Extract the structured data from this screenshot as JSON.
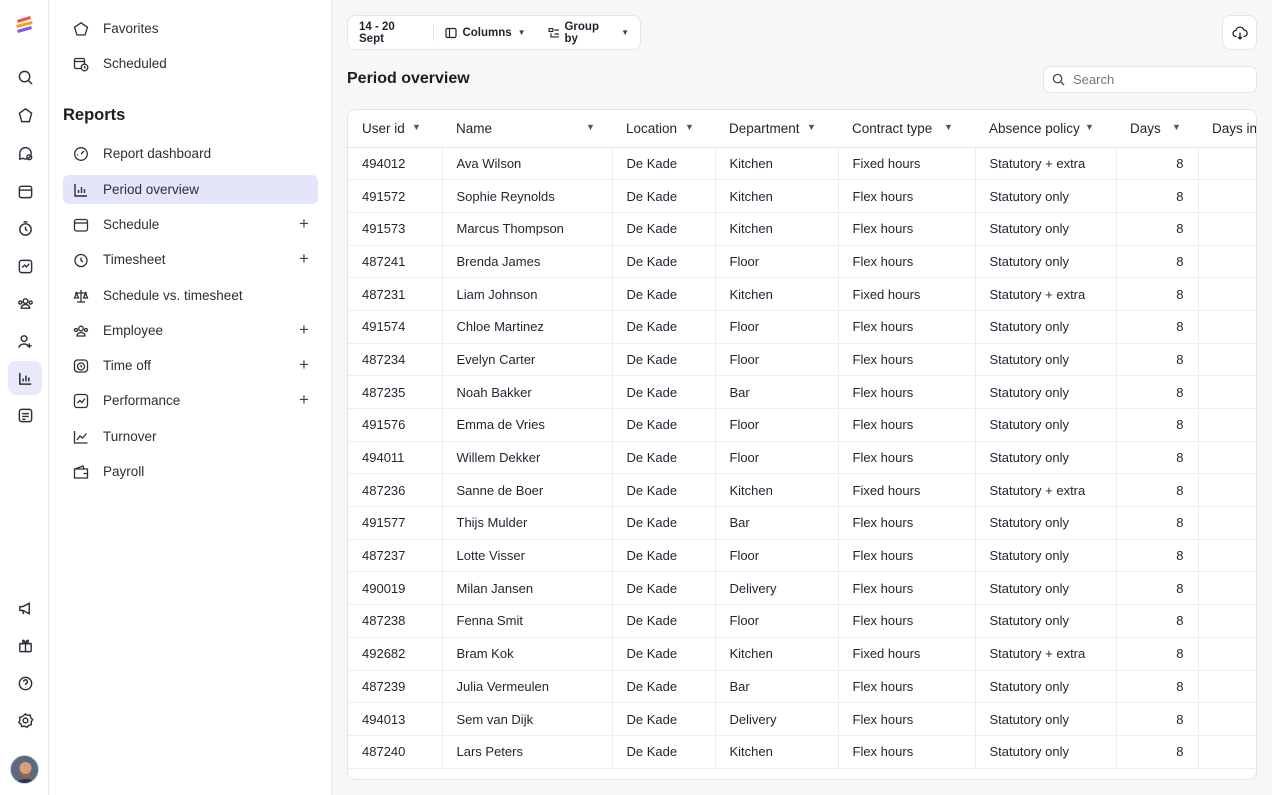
{
  "rail": {
    "icons": [
      "search-icon",
      "inbox-icon",
      "chat-icon",
      "calendar-icon",
      "clock-icon",
      "check-square-icon",
      "team-icon",
      "add-user-icon",
      "reports-icon",
      "list-icon"
    ],
    "bottom_icons": [
      "megaphone-icon",
      "gift-icon",
      "help-icon",
      "settings-icon"
    ]
  },
  "sidebar": {
    "favorites": "Favorites",
    "scheduled": "Scheduled",
    "section_title": "Reports",
    "items": [
      {
        "label": "Report dashboard",
        "icon": "dashboard-icon",
        "expandable": false
      },
      {
        "label": "Period overview",
        "icon": "bar-chart-icon",
        "expandable": false,
        "active": true
      },
      {
        "label": "Schedule",
        "icon": "calendar-icon",
        "expandable": true
      },
      {
        "label": "Timesheet",
        "icon": "clock-icon",
        "expandable": true
      },
      {
        "label": "Schedule vs. timesheet",
        "icon": "scale-icon",
        "expandable": false
      },
      {
        "label": "Employee",
        "icon": "team-icon",
        "expandable": true
      },
      {
        "label": "Time off",
        "icon": "alarm-icon",
        "expandable": true
      },
      {
        "label": "Performance",
        "icon": "chart-square-icon",
        "expandable": true
      },
      {
        "label": "Turnover",
        "icon": "trend-line-icon",
        "expandable": false
      },
      {
        "label": "Payroll",
        "icon": "wallet-icon",
        "expandable": false
      }
    ]
  },
  "toolbar": {
    "date_range": "14 - 20 Sept",
    "columns_label": "Columns",
    "group_by_label": "Group by"
  },
  "main": {
    "title": "Period overview",
    "search_placeholder": "Search"
  },
  "table": {
    "columns": [
      "User id",
      "Name",
      "Location",
      "Department",
      "Contract type",
      "Absence policy",
      "Days",
      "Days in"
    ],
    "rows": [
      [
        "494012",
        "Ava Wilson",
        "De Kade",
        "Kitchen",
        "Fixed hours",
        "Statutory + extra",
        "8"
      ],
      [
        "491572",
        "Sophie Reynolds",
        "De Kade",
        "Kitchen",
        "Flex hours",
        "Statutory only",
        "8"
      ],
      [
        "491573",
        "Marcus Thompson",
        "De Kade",
        "Kitchen",
        "Flex hours",
        "Statutory only",
        "8"
      ],
      [
        "487241",
        "Brenda James",
        "De Kade",
        "Floor",
        "Flex hours",
        "Statutory only",
        "8"
      ],
      [
        "487231",
        "Liam Johnson",
        "De Kade",
        "Kitchen",
        "Fixed hours",
        "Statutory + extra",
        "8"
      ],
      [
        "491574",
        "Chloe Martinez",
        "De Kade",
        "Floor",
        "Flex hours",
        "Statutory only",
        "8"
      ],
      [
        "487234",
        "Evelyn Carter",
        "De Kade",
        "Floor",
        "Flex hours",
        "Statutory only",
        "8"
      ],
      [
        "487235",
        "Noah Bakker",
        "De Kade",
        "Bar",
        "Flex hours",
        "Statutory only",
        "8"
      ],
      [
        "491576",
        "Emma de Vries",
        "De Kade",
        "Floor",
        "Flex hours",
        "Statutory only",
        "8"
      ],
      [
        "494011",
        "Willem Dekker",
        "De Kade",
        "Floor",
        "Flex hours",
        "Statutory only",
        "8"
      ],
      [
        "487236",
        "Sanne de Boer",
        "De Kade",
        "Kitchen",
        "Fixed hours",
        "Statutory + extra",
        "8"
      ],
      [
        "491577",
        "Thijs Mulder",
        "De Kade",
        "Bar",
        "Flex hours",
        "Statutory only",
        "8"
      ],
      [
        "487237",
        "Lotte Visser",
        "De Kade",
        "Floor",
        "Flex hours",
        "Statutory only",
        "8"
      ],
      [
        "490019",
        "Milan Jansen",
        "De Kade",
        "Delivery",
        "Flex hours",
        "Statutory only",
        "8"
      ],
      [
        "487238",
        "Fenna Smit",
        "De Kade",
        "Floor",
        "Flex hours",
        "Statutory only",
        "8"
      ],
      [
        "492682",
        "Bram Kok",
        "De Kade",
        "Kitchen",
        "Fixed hours",
        "Statutory + extra",
        "8"
      ],
      [
        "487239",
        "Julia Vermeulen",
        "De Kade",
        "Bar",
        "Flex hours",
        "Statutory only",
        "8"
      ],
      [
        "494013",
        "Sem van Dijk",
        "De Kade",
        "Delivery",
        "Flex hours",
        "Statutory only",
        "8"
      ],
      [
        "487240",
        "Lars Peters",
        "De Kade",
        "Kitchen",
        "Flex hours",
        "Statutory only",
        "8"
      ]
    ]
  }
}
